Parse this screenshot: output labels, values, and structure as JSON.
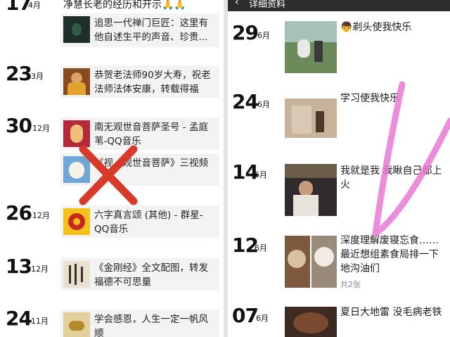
{
  "left_feed": {
    "entries": [
      {
        "day": "17",
        "month": "4月",
        "text": "净慧长老的经历和开示🙏🙏",
        "thumb": "none"
      },
      {
        "day": "",
        "month": "",
        "text": "追思一代禅门巨匠：这里有他自述生平的声音、珍贵...",
        "thumb": "dark-green"
      },
      {
        "day": "23",
        "month": "3月",
        "text": "恭贺老法师90岁大寿，祝老法师法体安康，转载得福",
        "thumb": "monk"
      },
      {
        "day": "30",
        "month": "12月",
        "text": "南无观世音菩萨圣号 - 孟庭苇-QQ音乐",
        "thumb": "guanyin-red"
      },
      {
        "day": "",
        "month": "",
        "text": "《视《观世音菩萨》三视频",
        "thumb": "guanyin-blue"
      },
      {
        "day": "26",
        "month": "12月",
        "text": "六字真言颂 (其他) - 群星-QQ音乐",
        "thumb": "mandala"
      },
      {
        "day": "13",
        "month": "12月",
        "text": "《金刚经》全文配图，转发福德不可思量",
        "thumb": "calligraphy"
      },
      {
        "day": "24",
        "month": "11月",
        "text": "学会感恩，人生一定一帆风顺",
        "thumb": "gold"
      }
    ]
  },
  "right_feed": {
    "header_title": "详细资料",
    "entries": [
      {
        "day": "29",
        "month": "6月",
        "text": "👦剃头使我快乐",
        "count": ""
      },
      {
        "day": "24",
        "month": "6月",
        "text": "学习使我快乐",
        "count": ""
      },
      {
        "day": "14",
        "month": "6月",
        "text": "我就是我  我瞅自己都上火",
        "count": ""
      },
      {
        "day": "12",
        "month": "6月",
        "text": "深度理解废寝忘食……最近想组素食局排一下地沟油们",
        "count": "共2张"
      },
      {
        "day": "07",
        "month": "6月",
        "text": "夏日大地雷 没毛病老铁",
        "count": ""
      }
    ]
  },
  "annotations": {
    "cross_color": "#d83a2a",
    "check_color": "#e879d4"
  },
  "icons": {
    "back": "chevron-left-icon"
  }
}
